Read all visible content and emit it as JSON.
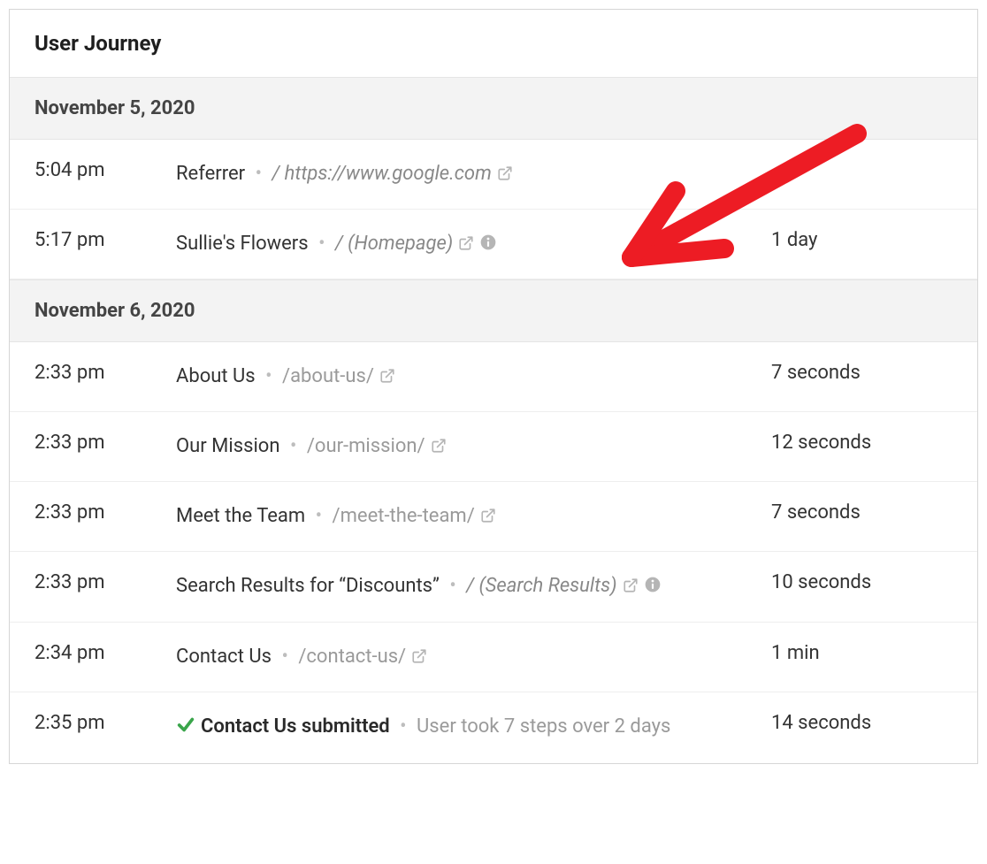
{
  "header": {
    "title": "User Journey"
  },
  "groups": [
    {
      "date": "November 5, 2020",
      "entries": [
        {
          "time": "5:04 pm",
          "title": "Referrer",
          "path_prefix": "/ ",
          "path": "https://www.google.com",
          "path_italic": true,
          "has_external": true,
          "has_info": false,
          "duration": "",
          "bold": false,
          "submitted": false
        },
        {
          "time": "5:17 pm",
          "title": "Sullie's Flowers",
          "path_prefix": "/ ",
          "path": "(Homepage)",
          "path_italic": true,
          "has_external": true,
          "has_info": true,
          "duration": "1 day",
          "bold": false,
          "submitted": false
        }
      ]
    },
    {
      "date": "November 6, 2020",
      "entries": [
        {
          "time": "2:33 pm",
          "title": "About Us",
          "path_prefix": "",
          "path": "/about-us/",
          "path_italic": false,
          "has_external": true,
          "has_info": false,
          "duration": "7 seconds",
          "bold": false,
          "submitted": false
        },
        {
          "time": "2:33 pm",
          "title": "Our Mission",
          "path_prefix": "",
          "path": "/our-mission/",
          "path_italic": false,
          "has_external": true,
          "has_info": false,
          "duration": "12 seconds",
          "bold": false,
          "submitted": false
        },
        {
          "time": "2:33 pm",
          "title": "Meet the Team",
          "path_prefix": "",
          "path": "/meet-the-team/",
          "path_italic": false,
          "has_external": true,
          "has_info": false,
          "duration": "7 seconds",
          "bold": false,
          "submitted": false
        },
        {
          "time": "2:33 pm",
          "title": "Search Results for “Discounts”",
          "path_prefix": "/ ",
          "path": "(Search Results)",
          "path_italic": true,
          "has_external": true,
          "has_info": true,
          "duration": "10 seconds",
          "bold": false,
          "submitted": false
        },
        {
          "time": "2:34 pm",
          "title": "Contact Us",
          "path_prefix": "",
          "path": "/contact-us/",
          "path_italic": false,
          "has_external": true,
          "has_info": false,
          "duration": "1 min",
          "bold": false,
          "submitted": false
        },
        {
          "time": "2:35 pm",
          "title": "Contact Us submitted",
          "path_prefix": "",
          "path": "",
          "path_italic": false,
          "has_external": false,
          "has_info": false,
          "duration": "14 seconds",
          "bold": true,
          "submitted": true,
          "meta": "User took 7 steps over 2 days"
        }
      ]
    }
  ],
  "icons": {
    "external_color": "#b5b5b5",
    "info_color": "#b5b5b5",
    "check_color": "#3aa54b",
    "arrow_color": "#ed1c24"
  }
}
